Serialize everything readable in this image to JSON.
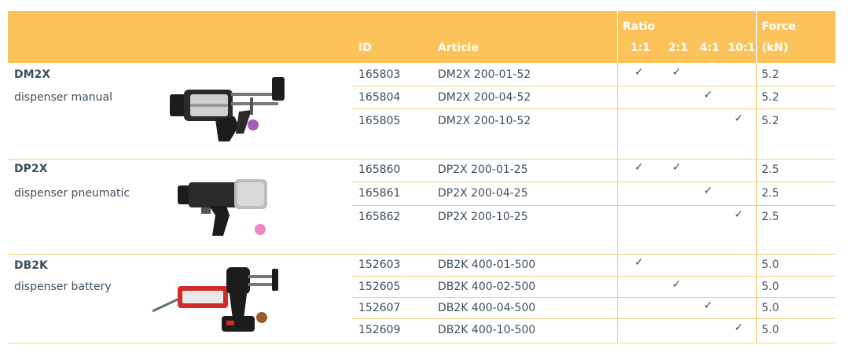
{
  "header": {
    "id": "ID",
    "article": "Article",
    "ratio": "Ratio",
    "ratio_cols": [
      "1:1",
      "2:1",
      "4:1",
      "10:1"
    ],
    "force_line1": "Force",
    "force_line2": "(kN)"
  },
  "check_mark": "✓",
  "groups": [
    {
      "title": "DM2X",
      "subtitle": "dispenser manual",
      "dot_color": "#a45bb8",
      "rows": [
        {
          "id": "165803",
          "article": "DM2X 200-01-52",
          "ratios": [
            true,
            true,
            false,
            false
          ],
          "force": "5.2"
        },
        {
          "id": "165804",
          "article": "DM2X 200-04-52",
          "ratios": [
            false,
            false,
            true,
            false
          ],
          "force": "5.2"
        },
        {
          "id": "165805",
          "article": "DM2X 200-10-52",
          "ratios": [
            false,
            false,
            false,
            true
          ],
          "force": "5.2"
        }
      ]
    },
    {
      "title": "DP2X",
      "subtitle": "dispenser pneumatic",
      "dot_color": "#ea86c4",
      "rows": [
        {
          "id": "165860",
          "article": "DP2X 200-01-25",
          "ratios": [
            true,
            true,
            false,
            false
          ],
          "force": "2.5"
        },
        {
          "id": "165861",
          "article": "DP2X 200-04-25",
          "ratios": [
            false,
            false,
            true,
            false
          ],
          "force": "2.5"
        },
        {
          "id": "165862",
          "article": "DP2X 200-10-25",
          "ratios": [
            false,
            false,
            false,
            true
          ],
          "force": "2.5"
        }
      ]
    },
    {
      "title": "DB2K",
      "subtitle": "dispenser battery",
      "dot_color": "#9b5a30",
      "rows": [
        {
          "id": "152603",
          "article": "DB2K 400-01-500",
          "ratios": [
            true,
            false,
            false,
            false
          ],
          "force": "5.0"
        },
        {
          "id": "152605",
          "article": "DB2K 400-02-500",
          "ratios": [
            false,
            true,
            false,
            false
          ],
          "force": "5.0"
        },
        {
          "id": "152607",
          "article": "DB2K 400-04-500",
          "ratios": [
            false,
            false,
            true,
            false
          ],
          "force": "5.0"
        },
        {
          "id": "152609",
          "article": "DB2K 400-10-500",
          "ratios": [
            false,
            false,
            false,
            true
          ],
          "force": "5.0"
        }
      ]
    }
  ]
}
